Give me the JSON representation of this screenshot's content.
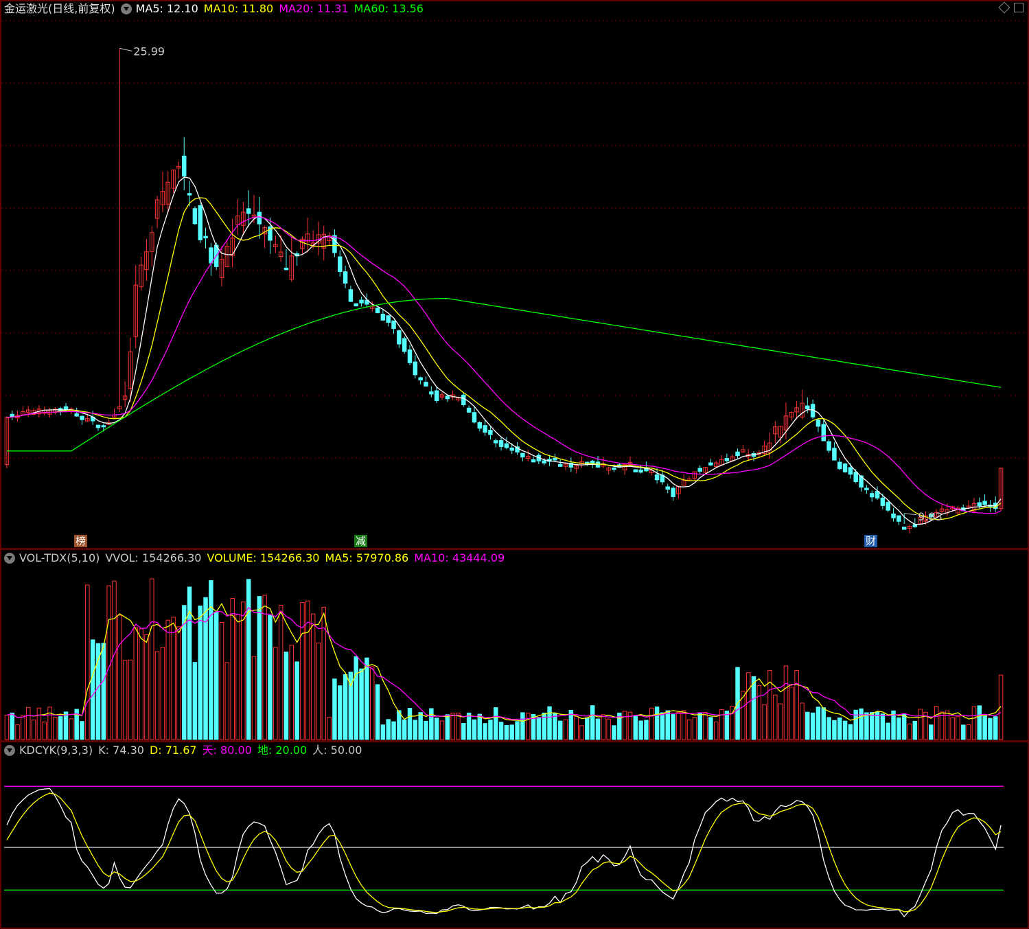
{
  "colors": {
    "up": "#ff3333",
    "down": "#54ffff",
    "ma5": "#ffffff",
    "ma10": "#ffff00",
    "ma20": "#ff00ff",
    "ma60": "#00ff00",
    "grid": "#7a0000",
    "frame": "#c00000",
    "k": "#ffffff",
    "d": "#ffff00",
    "sky": "#ff00ff",
    "earth": "#00ff00",
    "man": "#ffffff"
  },
  "main_header": {
    "title": "金运激光(日线,前复权)",
    "ma5": "MA5: 12.10",
    "ma10": "MA10: 11.80",
    "ma20": "MA20: 11.31",
    "ma60": "MA60: 13.56"
  },
  "vol_header": {
    "title": "VOL-TDX(5,10)",
    "vvol": "VVOL: 154266.30",
    "volume": "VOLUME: 154266.30",
    "ma5": "MA5: 57970.86",
    "ma10": "MA10: 43444.09"
  },
  "kd_header": {
    "title": "KDCYK(9,3,3)",
    "k": "K: 74.30",
    "d": "D: 71.67",
    "sky": "天: 80.00",
    "earth": "地: 20.00",
    "man": "人: 50.00"
  },
  "badges": {
    "bang": "榜",
    "jian": "减",
    "cai": "财"
  },
  "icons": [
    "collapse-icon",
    "diamond-icon",
    "square-icon"
  ],
  "chart_data": [
    {
      "type": "candlestick",
      "title": "金运激光(日线,前复权)",
      "ylim": [
        9.3,
        27.0
      ],
      "high_mark": "25.99",
      "low_mark": "9.83",
      "series": [
        {
          "name": "MA5"
        },
        {
          "name": "MA10"
        },
        {
          "name": "MA20"
        },
        {
          "name": "MA60"
        }
      ]
    },
    {
      "type": "bar",
      "title": "VOL-TDX(5,10)",
      "series": [
        {
          "name": "VOLUME"
        },
        {
          "name": "MA5"
        },
        {
          "name": "MA10"
        }
      ]
    },
    {
      "type": "line",
      "title": "KDCYK(9,3,3)",
      "ylim": [
        -5,
        110
      ],
      "series": [
        {
          "name": "K"
        },
        {
          "name": "D"
        }
      ],
      "levels": {
        "天": 80,
        "地": 20,
        "人": 50
      }
    }
  ]
}
